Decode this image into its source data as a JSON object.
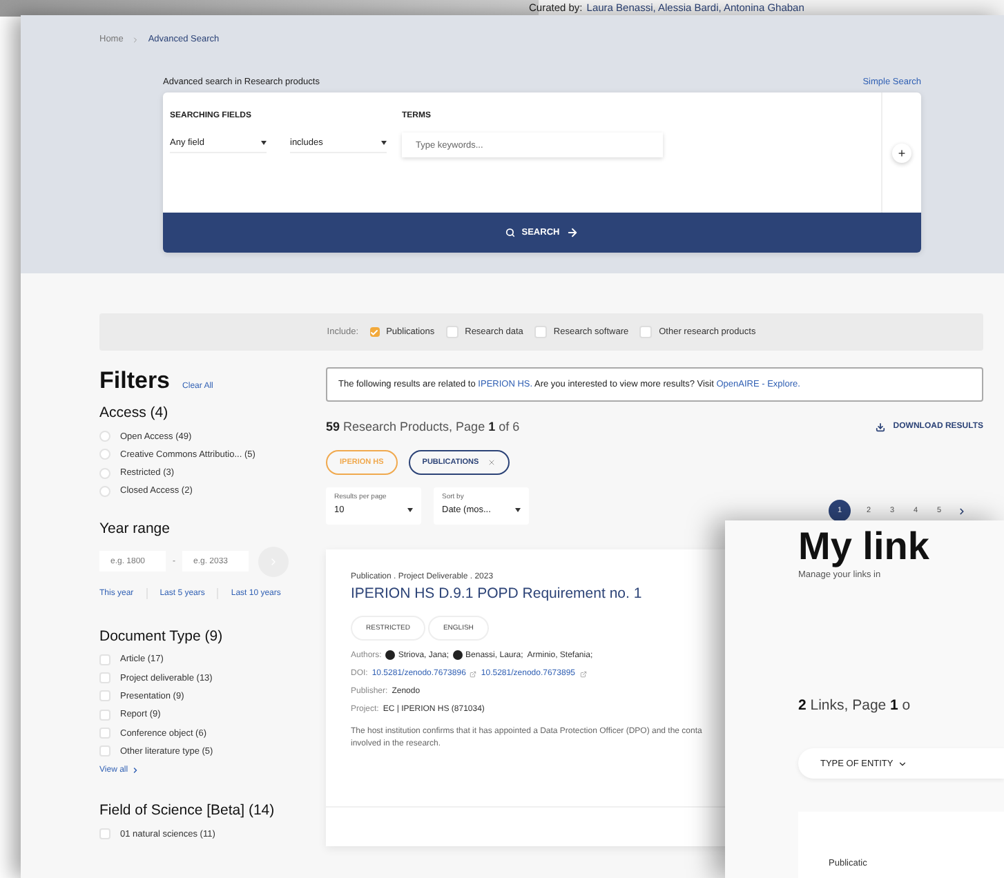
{
  "back_window": {
    "curated_label": "Curated by:",
    "curators": "Laura Benassi, Alessia Bardi, Antonina Ghaban"
  },
  "breadcrumb": [
    {
      "label": "Home",
      "selected": false
    },
    {
      "label": "Advanced Search",
      "selected": true
    }
  ],
  "advanced_search": {
    "title": "Advanced search in Research products",
    "simple_search_link": "Simple Search",
    "fields_heading": "SEARCHING FIELDS",
    "terms_heading": "TERMS",
    "field_select": "Any field",
    "operator_select": "includes",
    "terms_placeholder": "Type keywords...",
    "add_button": "+",
    "search_button": "SEARCH"
  },
  "include": {
    "label": "Include:",
    "options": [
      {
        "label": "Publications",
        "checked": true
      },
      {
        "label": "Research data",
        "checked": false
      },
      {
        "label": "Research software",
        "checked": false
      },
      {
        "label": "Other research products",
        "checked": false
      }
    ]
  },
  "filters": {
    "title": "Filters",
    "clear_all": "Clear All",
    "access": {
      "title": "Access (4)",
      "options": [
        {
          "label": "Open Access (49)",
          "selected": false
        },
        {
          "label": "Creative Commons Attributio... (5)",
          "selected": false
        },
        {
          "label": "Restricted (3)",
          "selected": false
        },
        {
          "label": "Closed Access (2)",
          "selected": false
        }
      ]
    },
    "year_range": {
      "title": "Year range",
      "from_placeholder": "e.g. 1800",
      "separator": "-",
      "to_placeholder": "e.g. 2033",
      "shortcuts": [
        "This year",
        "Last 5 years",
        "Last 10 years"
      ]
    },
    "document_type": {
      "title": "Document Type (9)",
      "options": [
        {
          "label": "Article (17)",
          "checked": false
        },
        {
          "label": "Project deliverable (13)",
          "checked": false
        },
        {
          "label": "Presentation (9)",
          "checked": false
        },
        {
          "label": "Report (9)",
          "checked": false
        },
        {
          "label": "Conference object (6)",
          "checked": false
        },
        {
          "label": "Other literature type (5)",
          "checked": false
        }
      ],
      "view_all": "View all"
    },
    "field_of_science": {
      "title": "Field of Science [Beta] (14)",
      "options": [
        {
          "label": "01 natural sciences (11)",
          "checked": false
        }
      ]
    }
  },
  "notice": {
    "prefix": "The following results are related to",
    "highlight": "IPERION HS.",
    "middle": "Are you interested to view more results? Visit",
    "link": "OpenAIRE - Explore."
  },
  "results": {
    "summary": "**59** Research Products, Page **1** of 6",
    "download": "DOWNLOAD RESULTS",
    "chips": [
      {
        "label": "IPERION HS",
        "removable": false,
        "color": "#f0a94e"
      },
      {
        "label": "PUBLICATIONS",
        "removable": true,
        "color": "#2c4377"
      }
    ],
    "per_page": {
      "label": "Results per page",
      "value": "10"
    },
    "sort": {
      "label": "Sort by",
      "value": "Date (mos..."
    },
    "pagination": [
      {
        "label": "1",
        "selected": true
      },
      {
        "label": "2",
        "selected": false
      },
      {
        "label": "3",
        "selected": false
      },
      {
        "label": "4",
        "selected": false
      },
      {
        "label": "5",
        "selected": false
      }
    ]
  },
  "result_card": {
    "meta": "Publication . Project Deliverable . 2023",
    "title": "IPERION HS D.9.1 POPD Requirement no. 1",
    "tags": [
      "RESTRICTED",
      "ENGLISH"
    ],
    "authors_label": "Authors:",
    "authors": [
      {
        "name": "Striova, Jana;",
        "orcid": true
      },
      {
        "name": "Benassi, Laura;",
        "orcid": true
      },
      {
        "name": "Arminio, Stefania;",
        "orcid": false
      }
    ],
    "doi_label": "DOI:",
    "dois": [
      "10.5281/zenodo.7673896",
      "10.5281/zenodo.7673895"
    ],
    "publisher_label": "Publisher:",
    "publisher": "Zenodo",
    "project_label": "Project:",
    "project": "EC | IPERION HS (871034)",
    "description_lines": [
      "The host institution confirms that it has appointed a Data Protection Officer (DPO) and the conta",
      "involved in the research."
    ]
  },
  "links_window": {
    "title": "My link",
    "subtitle": "Manage your links in",
    "summary": "**2** Links, Page **1** o",
    "entity_filter": "TYPE OF ENTITY",
    "card_type": "Publicatic"
  }
}
